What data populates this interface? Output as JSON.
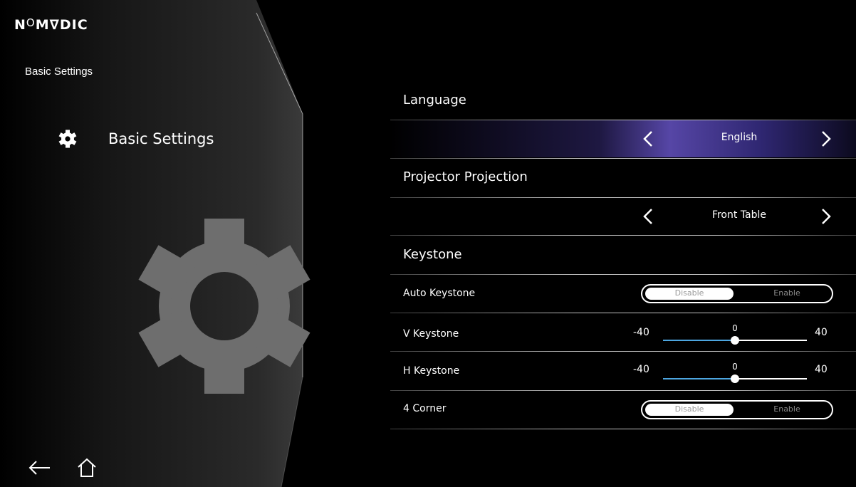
{
  "brand": {
    "logo_prefix": "N",
    "logo_sup": "O",
    "logo_rest": "M∇DIC"
  },
  "page_title": "Basic Settings",
  "sidebar": {
    "items": [
      {
        "label": "Basic Settings",
        "icon": "gear-icon"
      }
    ]
  },
  "nav": {
    "back_icon": "back-arrow-icon",
    "home_icon": "home-icon"
  },
  "settings": {
    "language": {
      "header": "Language",
      "value": "English"
    },
    "projection": {
      "header": "Projector Projection",
      "value": "Front Table"
    },
    "keystone": {
      "header": "Keystone",
      "auto_keystone": {
        "label": "Auto Keystone",
        "off": "Disable",
        "on": "Enable",
        "selected": "Disable"
      },
      "v_keystone": {
        "label": "V Keystone",
        "min": "-40",
        "max": "40",
        "value": "0",
        "fraction": 0.5
      },
      "h_keystone": {
        "label": "H Keystone",
        "min": "-40",
        "max": "40",
        "value": "0",
        "fraction": 0.5
      },
      "four_corner": {
        "label": "4 Corner",
        "off": "Disable",
        "on": "Enable",
        "selected": "Disable"
      }
    }
  },
  "colors": {
    "accent_active": "#5646a6",
    "slider_fill": "#4da6e0",
    "panel_gear": "#6e6e6e"
  }
}
